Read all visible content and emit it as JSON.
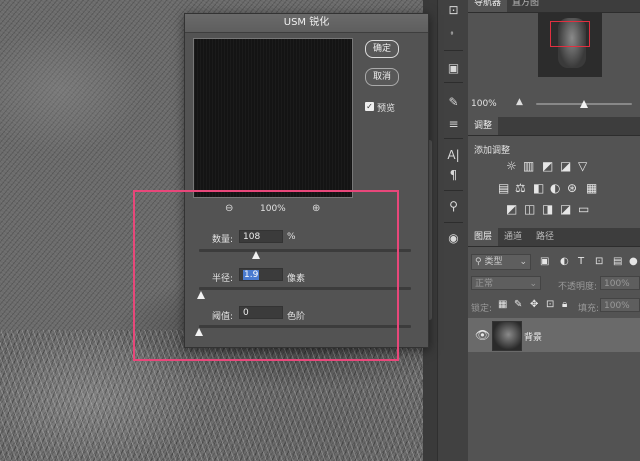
{
  "dialog": {
    "title": "USM 锐化",
    "ok_label": "确定",
    "cancel_label": "取消",
    "preview_label": "预览",
    "preview_checked": true,
    "zoom_value": "100%",
    "zoom_out_icon": "zoom-out-icon",
    "zoom_in_icon": "zoom-in-icon",
    "amount": {
      "label": "数量:",
      "value": "108",
      "unit": "%",
      "slider_fraction": 0.27
    },
    "radius": {
      "label": "半径:",
      "value": "1.9",
      "unit": "像素",
      "slider_fraction": 0.01
    },
    "threshold": {
      "label": "阈值:",
      "value": "0",
      "unit": "色阶",
      "slider_fraction": 0.0
    }
  },
  "highlight_color": "#e8477a",
  "navigator": {
    "tabs": [
      "导航器",
      "直方图"
    ],
    "zoom_value": "100%"
  },
  "adjustments": {
    "tab": "调整",
    "title": "添加调整"
  },
  "layers": {
    "tabs": [
      "图层",
      "通道",
      "路径"
    ],
    "filter_kind": "类型",
    "blend_mode": "正常",
    "opacity_label": "不透明度:",
    "opacity_value": "100%",
    "lock_label": "锁定:",
    "fill_label": "填充:",
    "fill_value": "100%",
    "items": [
      {
        "name": "背景",
        "visible": true
      }
    ]
  },
  "tools": [
    "brush-settings-icon",
    "swatch-icon",
    "properties-icon",
    "paragraph-style-icon",
    "adjust-icon",
    "character-icon",
    "paragraph-icon",
    "path-icon",
    "cc-libraries-icon"
  ]
}
